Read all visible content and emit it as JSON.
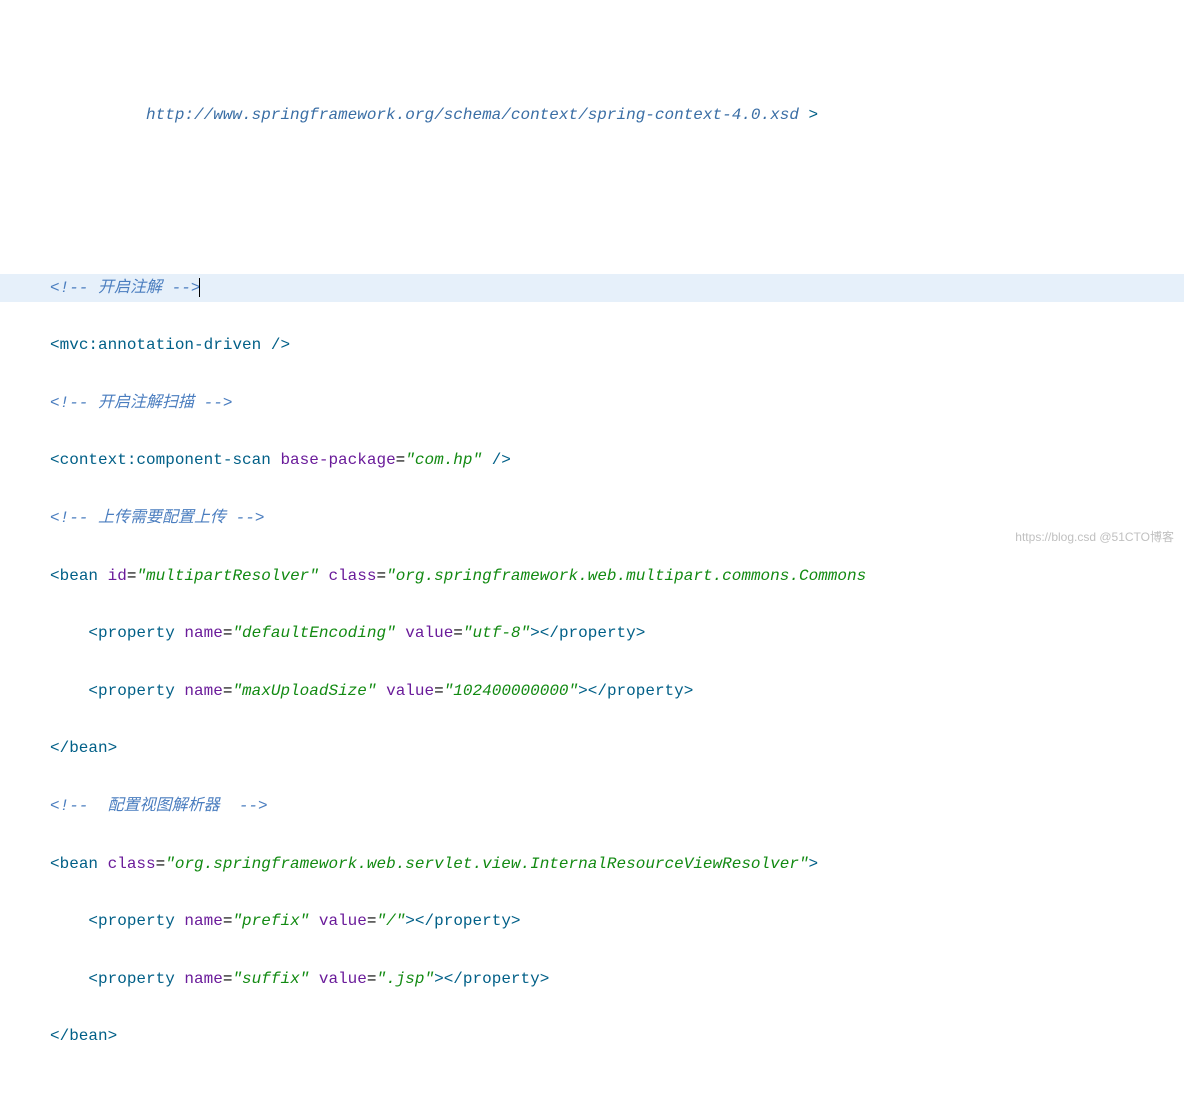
{
  "top_url": "http://www.springframework.org/schema/context/spring-context-4.0.xsd",
  "top_url_end": " >",
  "lines": {
    "l1": {
      "comment": "<!-- 开启注解 -->"
    },
    "l2": {
      "open": "<",
      "tag": "mvc:annotation-driven",
      "close": " />"
    },
    "l3": {
      "comment": "<!-- 开启注解扫描 -->"
    },
    "l4": {
      "open": "<",
      "tag": "context:component-scan",
      "attr1": " base-package",
      "eq": "=",
      "val1": "\"com.hp\"",
      "close": " />"
    },
    "l5": {
      "comment": "<!-- 上传需要配置上传 -->"
    },
    "l6": {
      "open": "<",
      "tag": "bean",
      "attr1": " id",
      "eq1": "=",
      "val1": "\"multipartResolver\"",
      "attr2": " class",
      "eq2": "=",
      "val2": "\"org.springframework.web.multipart.commons.Commons"
    },
    "l7": {
      "indent": "    ",
      "open": "<",
      "tag": "property",
      "attr1": " name",
      "eq1": "=",
      "val1": "\"defaultEncoding\"",
      "attr2": " value",
      "eq2": "=",
      "val2": "\"utf-8\"",
      "mid": ">",
      "close_open": "</",
      "close_tag": "property",
      "close": ">"
    },
    "l8": {
      "indent": "    ",
      "open": "<",
      "tag": "property",
      "attr1": " name",
      "eq1": "=",
      "val1": "\"maxUploadSize\"",
      "attr2": " value",
      "eq2": "=",
      "val2": "\"102400000000\"",
      "mid": ">",
      "close_open": "</",
      "close_tag": "property",
      "close": ">"
    },
    "l9": {
      "open": "</",
      "tag": "bean",
      "close": ">"
    },
    "l10": {
      "comment": "<!--  配置视图解析器  -->"
    },
    "l11": {
      "open": "<",
      "tag": "bean",
      "attr1": " class",
      "eq1": "=",
      "val1": "\"org.springframework.web.servlet.view.InternalResourceViewResolver\"",
      "close": ">"
    },
    "l12": {
      "indent": "    ",
      "open": "<",
      "tag": "property",
      "attr1": " name",
      "eq1": "=",
      "val1": "\"prefix\"",
      "attr2": " value",
      "eq2": "=",
      "val2": "\"/\"",
      "mid": ">",
      "close_open": "</",
      "close_tag": "property",
      "close": ">"
    },
    "l13": {
      "indent": "    ",
      "open": "<",
      "tag": "property",
      "attr1": " name",
      "eq1": "=",
      "val1": "\"suffix\"",
      "attr2": " value",
      "eq2": "=",
      "val2": "\".jsp\"",
      "mid": ">",
      "close_open": "</",
      "close_tag": "property",
      "close": ">"
    },
    "l14": {
      "open": "</",
      "tag": "bean",
      "close": ">"
    }
  },
  "watermark": "https://blog.csd @51CTO博客"
}
